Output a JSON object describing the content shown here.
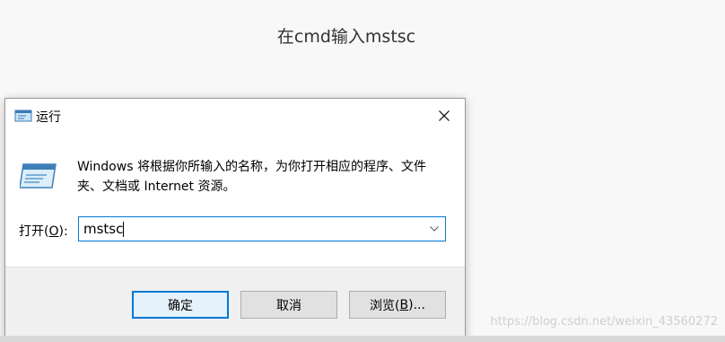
{
  "caption": "在cmd输入mstsc",
  "watermark": "https://blog.csdn.net/weixin_43560272",
  "dialog": {
    "title": "运行",
    "description": "Windows 将根据你所输入的名称，为你打开相应的程序、文件夹、文档或 Internet 资源。",
    "open_label_prefix": "打开(",
    "open_label_accel": "O",
    "open_label_suffix": "):",
    "input_value": "mstsc",
    "buttons": {
      "ok": "确定",
      "cancel": "取消",
      "browse_prefix": "浏览(",
      "browse_accel": "B",
      "browse_suffix": ")..."
    }
  },
  "icons": {
    "title": "run-app-icon",
    "close": "close-icon",
    "main": "run-program-icon",
    "dropdown": "chevron-down-icon"
  }
}
